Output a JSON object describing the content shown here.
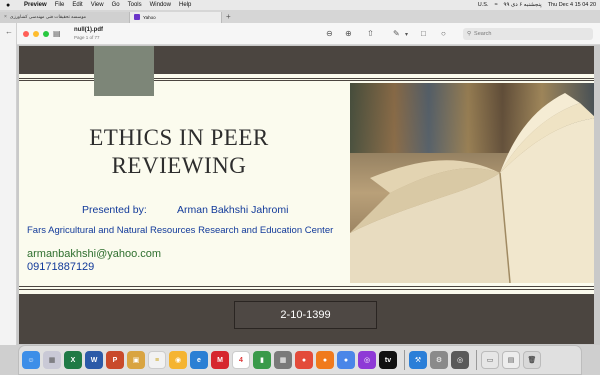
{
  "menubar": {
    "apple_icon": "",
    "items": [
      "Preview",
      "File",
      "Edit",
      "View",
      "Go",
      "Tools",
      "Window",
      "Help"
    ],
    "status_flag": "U.S.",
    "status_persian": "پنجشنبه ۶ دی ۹۹",
    "status_clock": "Thu Dec 4  15 04 20"
  },
  "tabs": {
    "tab1_label": "موسسه تحقیقات فنی مهندسی کشاورزی",
    "tab2_label": "Yahoo",
    "add_label": "+"
  },
  "toolbar": {
    "doc_title": "null(1).pdf",
    "page_info": "Page 1 of 77",
    "search_placeholder": "Search",
    "icons": [
      "sidebar-icon",
      "zoom-out-icon",
      "zoom-in-icon",
      "share-icon",
      "markup-icon",
      "rotate-icon",
      "info-icon",
      "search-icon"
    ]
  },
  "slide": {
    "title": "ETHICS IN PEER REVIEWING",
    "presented_by": "Presented by:",
    "presenter": "Arman Bakhshi Jahromi",
    "institute": "Fars Agricultural and Natural Resources Research and Education Center",
    "email": "armanbakhshi@yahoo.com",
    "phone": "09171887129",
    "date": "2-10-1399"
  },
  "dock": {
    "apps": [
      "finder",
      "launchpad",
      "excel",
      "word",
      "powerpoint",
      "preview",
      "notes",
      "safari",
      "edge",
      "mendeley",
      "calendar",
      "stocks",
      "grid",
      "chrome",
      "firefox",
      "chrome-2",
      "podcasts",
      "apple-tv",
      "xcode",
      "system-preferences",
      "quicktime",
      "photo-preview",
      "documents",
      "trash"
    ]
  },
  "colors": {
    "band": "#4b4540",
    "title": "#2d2d2d",
    "text_blue": "#123a9a",
    "email_green": "#2f6f2f",
    "ribbon": "#7d8678"
  }
}
